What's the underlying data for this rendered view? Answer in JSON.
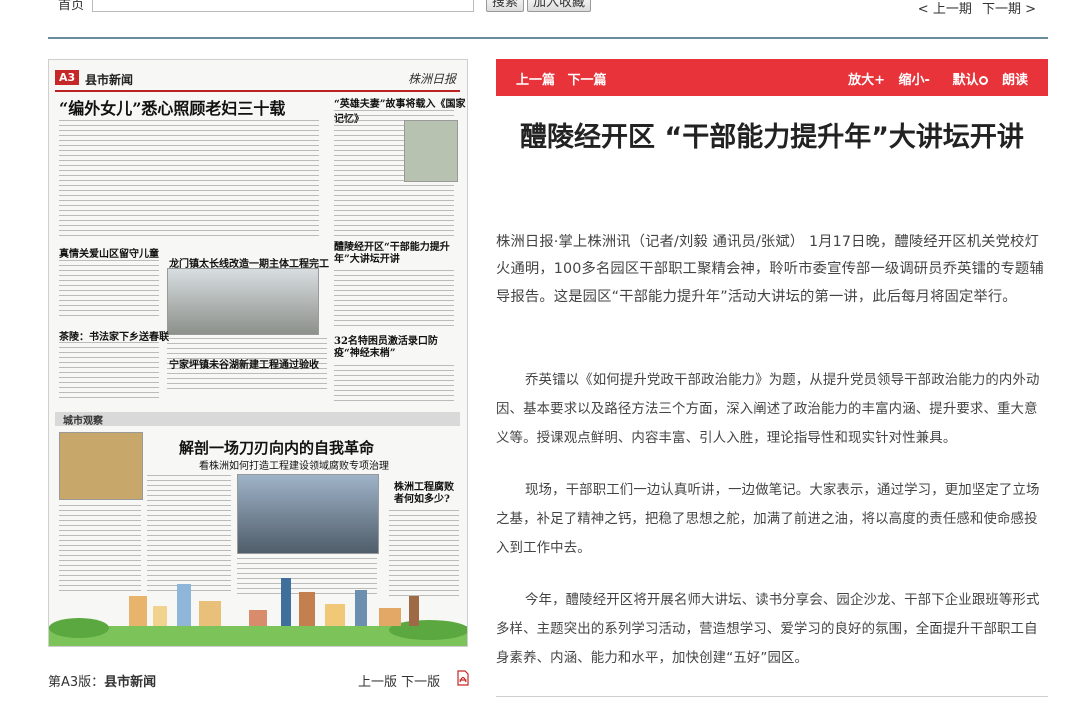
{
  "topbar": {
    "home_label": "首页",
    "search_button": "搜索",
    "favorite_button": "加入收藏",
    "prev_issue": "< 上一期",
    "next_issue": "下一期 >"
  },
  "paper": {
    "page_tag": "A3",
    "section": "县市新闻",
    "logo": "株洲日报",
    "headline": "“编外女儿”悉心照顾老妇三十载",
    "sub_headlines": [
      "“英雄夫妻”故事将载入《国家记忆》",
      "真情关爱山区留守儿童",
      "龙门镇太长线改造一期主体工程完工",
      "醴陵经开区“干部能力提升年”大讲坛开讲",
      "茶陵：书法家下乡送春联",
      "宁家坪镇未谷湖新建工程通过验收",
      "32名特困员激活录口防疫“神经末梢”"
    ],
    "band_label": "城市观察",
    "feature_headline": "解剖一场刀刃向内的自我革命",
    "feature_subtitle": "看株洲如何打造工程建设领域腐败专项治理",
    "side_heading": "株洲工程腐败者何如多少?"
  },
  "page_caption": {
    "prefix": "第A3版：",
    "section": "县市新闻",
    "prev_page": "上一版",
    "next_page": "下一版"
  },
  "article_toolbar": {
    "prev_article": "上一篇",
    "next_article": "下一篇",
    "zoom_in": "放大+",
    "zoom_out": "缩小-",
    "default": "默认",
    "read_aloud": "朗读"
  },
  "article": {
    "title": "醴陵经开区 “干部能力提升年”大讲坛开讲",
    "paragraphs": [
      "株洲日报·掌上株洲讯（记者/刘毅 通讯员/张斌） 1月17日晚，醴陵经开区机关党校灯火通明，100多名园区干部职工聚精会神，聆听市委宣传部一级调研员乔英镭的专题辅导报告。这是园区“干部能力提升年”活动大讲坛的第一讲，此后每月将固定举行。",
      "乔英镭以《如何提升党政干部政治能力》为题，从提升党员领导干部政治能力的内外动因、基本要求以及路径方法三个方面，深入阐述了政治能力的丰富内涵、提升要求、重大意义等。授课观点鲜明、内容丰富、引人入胜，理论指导性和现实针对性兼具。",
      "现场，干部职工们一边认真听讲，一边做笔记。大家表示，通过学习，更加坚定了立场之基，补足了精神之钙，把稳了思想之舵，加满了前进之油，将以高度的责任感和使命感投入到工作中去。",
      "今年，醴陵经开区将开展名师大讲坛、读书分享会、园企沙龙、干部下企业跟班等形式多样、主题突出的系列学习活动，营造想学习、爱学习的良好的氛围，全面提升干部职工自身素养、内涵、能力和水平，加快创建“五好”园区。"
    ]
  },
  "colors": {
    "accent_red": "#e8333a",
    "rule_blue": "#6a8b9b"
  }
}
